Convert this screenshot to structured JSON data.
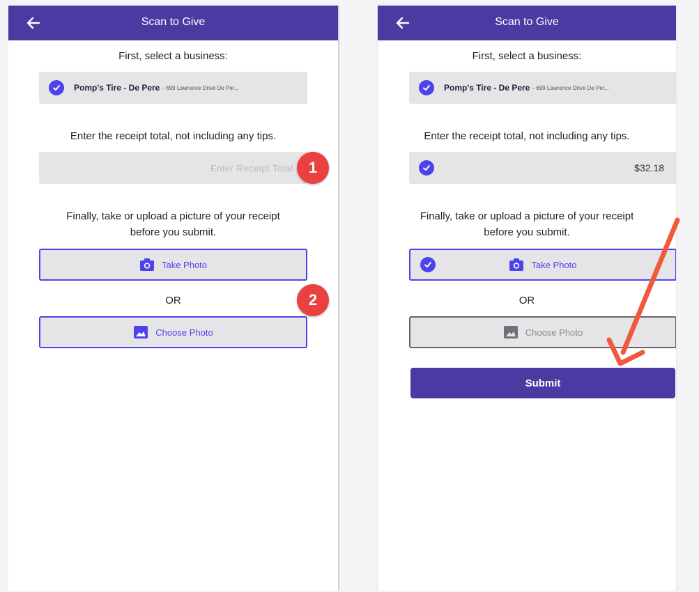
{
  "colors": {
    "appbar": "#4a3aa1",
    "accent": "#4d43ea",
    "field_bg": "#e5e5e7",
    "badge": "#ea4040",
    "arrow": "#f05a3c"
  },
  "screens": [
    {
      "title": "Scan to Give",
      "business_label": "First, select a business:",
      "business_name": "Pomp's Tire - De Pere",
      "business_address": "- 699 Lawrence Drive De Per...",
      "receipt_label": "Enter the receipt total, not including any tips.",
      "receipt_placeholder": "Enter Receipt Total",
      "photo_label_line1": "Finally, take or upload a picture of your receipt",
      "photo_label_line2": "before you submit.",
      "take_photo": "Take Photo",
      "or": "OR",
      "choose_photo": "Choose Photo",
      "badge_1": "1",
      "badge_2": "2"
    },
    {
      "title": "Scan to Give",
      "business_label": "First, select a business:",
      "business_name": "Pomp's Tire - De Pere",
      "business_address": "- 699 Lawrence Drive De Per...",
      "receipt_label": "Enter the receipt total, not including any tips.",
      "receipt_value": "$32.18",
      "photo_label_line1": "Finally, take or upload a picture of your receipt",
      "photo_label_line2": "before you submit.",
      "take_photo": "Take Photo",
      "or": "OR",
      "choose_photo": "Choose Photo",
      "submit": "Submit"
    }
  ],
  "icons": [
    "back-arrow-icon",
    "checkmark-icon",
    "camera-icon",
    "image-icon",
    "annotation-arrow-icon"
  ]
}
